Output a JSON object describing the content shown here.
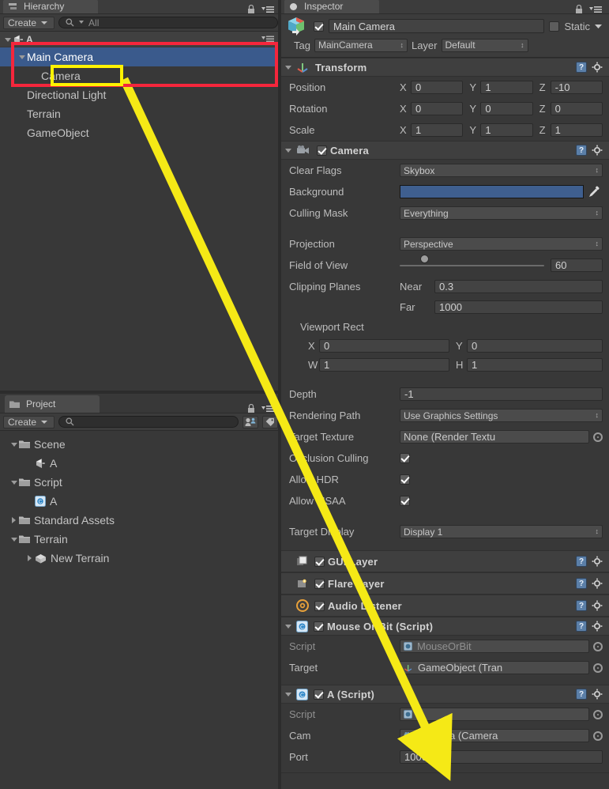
{
  "hierarchy": {
    "tab_label": "Hierarchy",
    "tab_icon": "hierarchy-icon",
    "create_label": "Create",
    "search_placeholder": "All",
    "search_value": "All",
    "scene_name": "A",
    "items": [
      {
        "label": "Main Camera",
        "indent": 1,
        "expandable": true,
        "expanded": true,
        "selected": true,
        "icon": ""
      },
      {
        "label": "Camera",
        "indent": 2,
        "expandable": false,
        "expanded": false,
        "selected": false,
        "icon": ""
      },
      {
        "label": "Directional Light",
        "indent": 1,
        "expandable": false,
        "expanded": false,
        "selected": false,
        "icon": ""
      },
      {
        "label": "Terrain",
        "indent": 1,
        "expandable": false,
        "expanded": false,
        "selected": false,
        "icon": ""
      },
      {
        "label": "GameObject",
        "indent": 1,
        "expandable": false,
        "expanded": false,
        "selected": false,
        "icon": ""
      }
    ]
  },
  "project": {
    "tab_label": "Project",
    "tab_icon": "folder-icon",
    "create_label": "Create",
    "search_placeholder": "",
    "search_value": "",
    "items": [
      {
        "label": "Scene",
        "indent": 0,
        "icon": "folder-icon",
        "expandable": true,
        "expanded": true
      },
      {
        "label": "A",
        "indent": 1,
        "icon": "scene-icon",
        "expandable": false,
        "expanded": false
      },
      {
        "label": "Script",
        "indent": 0,
        "icon": "folder-icon",
        "expandable": true,
        "expanded": true
      },
      {
        "label": "A",
        "indent": 1,
        "icon": "cs-script-icon",
        "expandable": false,
        "expanded": false
      },
      {
        "label": "Standard Assets",
        "indent": 0,
        "icon": "folder-icon",
        "expandable": true,
        "expanded": false
      },
      {
        "label": "Terrain",
        "indent": 0,
        "icon": "folder-icon",
        "expandable": true,
        "expanded": true
      },
      {
        "label": "New Terrain",
        "indent": 1,
        "icon": "terrain-icon",
        "expandable": true,
        "expanded": false
      }
    ]
  },
  "inspector": {
    "tab_label": "Inspector",
    "tab_icon": "inspector-icon",
    "object_name": "Main Camera",
    "object_enabled": true,
    "static_label": "Static",
    "static_checked": false,
    "tag_label": "Tag",
    "tag_value": "MainCamera",
    "layer_label": "Layer",
    "layer_value": "Default",
    "transform": {
      "title": "Transform",
      "enabled": true,
      "rows": [
        {
          "name": "Position",
          "x": "0",
          "y": "1",
          "z": "-10"
        },
        {
          "name": "Rotation",
          "x": "0",
          "y": "0",
          "z": "0"
        },
        {
          "name": "Scale",
          "x": "1",
          "y": "1",
          "z": "1"
        }
      ],
      "axis_labels": [
        "X",
        "Y",
        "Z"
      ]
    },
    "camera": {
      "title": "Camera",
      "enabled": true,
      "clear_flags_label": "Clear Flags",
      "clear_flags_value": "Skybox",
      "background_label": "Background",
      "background_color": "#3f5f8f",
      "culling_mask_label": "Culling Mask",
      "culling_mask_value": "Everything",
      "projection_label": "Projection",
      "projection_value": "Perspective",
      "fov_label": "Field of View",
      "fov_value": "60",
      "fov_percent": 14,
      "clipping_label": "Clipping Planes",
      "near_label": "Near",
      "near_value": "0.3",
      "far_label": "Far",
      "far_value": "1000",
      "viewport_label": "Viewport Rect",
      "viewport_x_label": "X",
      "viewport_x": "0",
      "viewport_y_label": "Y",
      "viewport_y": "0",
      "viewport_w_label": "W",
      "viewport_w": "1",
      "viewport_h_label": "H",
      "viewport_h": "1",
      "depth_label": "Depth",
      "depth_value": "-1",
      "rendering_path_label": "Rendering Path",
      "rendering_path_value": "Use Graphics Settings",
      "target_texture_label": "Target Texture",
      "target_texture_value": "None (Render Textu",
      "occlusion_label": "Occlusion Culling",
      "occlusion_checked": true,
      "hdr_label": "Allow HDR",
      "hdr_checked": true,
      "msaa_label": "Allow MSAA",
      "msaa_checked": true,
      "target_display_label": "Target Display",
      "target_display_value": "Display 1"
    },
    "components": [
      {
        "title": "GUI Layer",
        "enabled": true,
        "icon": "gui-layer-icon",
        "expandable": false
      },
      {
        "title": "Flare Layer",
        "enabled": true,
        "icon": "flare-layer-icon",
        "expandable": false
      },
      {
        "title": "Audio Listener",
        "enabled": true,
        "icon": "audio-listener-icon",
        "expandable": false
      }
    ],
    "mouse_or_bit": {
      "title": "Mouse Or Bit (Script)",
      "enabled": true,
      "script_label": "Script",
      "script_value": "MouseOrBit",
      "target_label": "Target",
      "target_value": "GameObject (Tran"
    },
    "a_script": {
      "title": "A (Script)",
      "enabled": true,
      "script_label": "Script",
      "script_value": "A",
      "cam_label": "Cam",
      "cam_value": "Camera (Camera",
      "port_label": "Port",
      "port_value": "10002"
    }
  },
  "annotations": {
    "red_box_name": "hierarchy-highlight-red-box",
    "red_box_color": "#f5263c",
    "yellow_box_name": "camera-child-highlight-yellow-box",
    "yellow_box_color": "#fff200",
    "arrow_name": "camera-reference-arrow",
    "arrow_color": "#f5e916"
  }
}
